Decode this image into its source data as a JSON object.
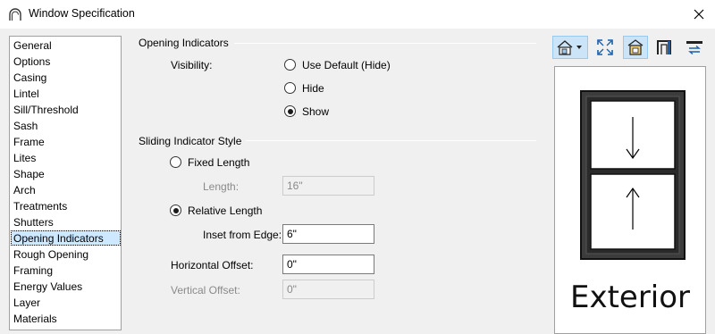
{
  "window": {
    "title": "Window Specification"
  },
  "nav": {
    "items": [
      "General",
      "Options",
      "Casing",
      "Lintel",
      "Sill/Threshold",
      "Sash",
      "Frame",
      "Lites",
      "Shape",
      "Arch",
      "Treatments",
      "Shutters",
      "Opening Indicators",
      "Rough Opening",
      "Framing",
      "Energy Values",
      "Layer",
      "Materials"
    ],
    "selected": "Opening Indicators"
  },
  "opening_indicators": {
    "group_title": "Opening Indicators",
    "visibility_label": "Visibility:",
    "options": [
      "Use Default (Hide)",
      "Hide",
      "Show"
    ],
    "selected": "Show"
  },
  "sliding_indicator": {
    "group_title": "Sliding Indicator Style",
    "fixed_length_label": "Fixed Length",
    "length_label": "Length:",
    "length_value": "16\"",
    "relative_length_label": "Relative Length",
    "inset_label": "Inset from Edge:",
    "inset_value": "6\"",
    "selected": "Relative Length"
  },
  "offsets": {
    "horizontal_label": "Horizontal Offset:",
    "horizontal_value": "0\"",
    "vertical_label": "Vertical Offset:",
    "vertical_value": "0\""
  },
  "toolbar": {
    "icons": [
      "view-elevation-icon",
      "fill-window-icon",
      "color-render-icon",
      "window-side-icon",
      "swap-view-icon"
    ]
  },
  "preview": {
    "label": "Exterior"
  }
}
